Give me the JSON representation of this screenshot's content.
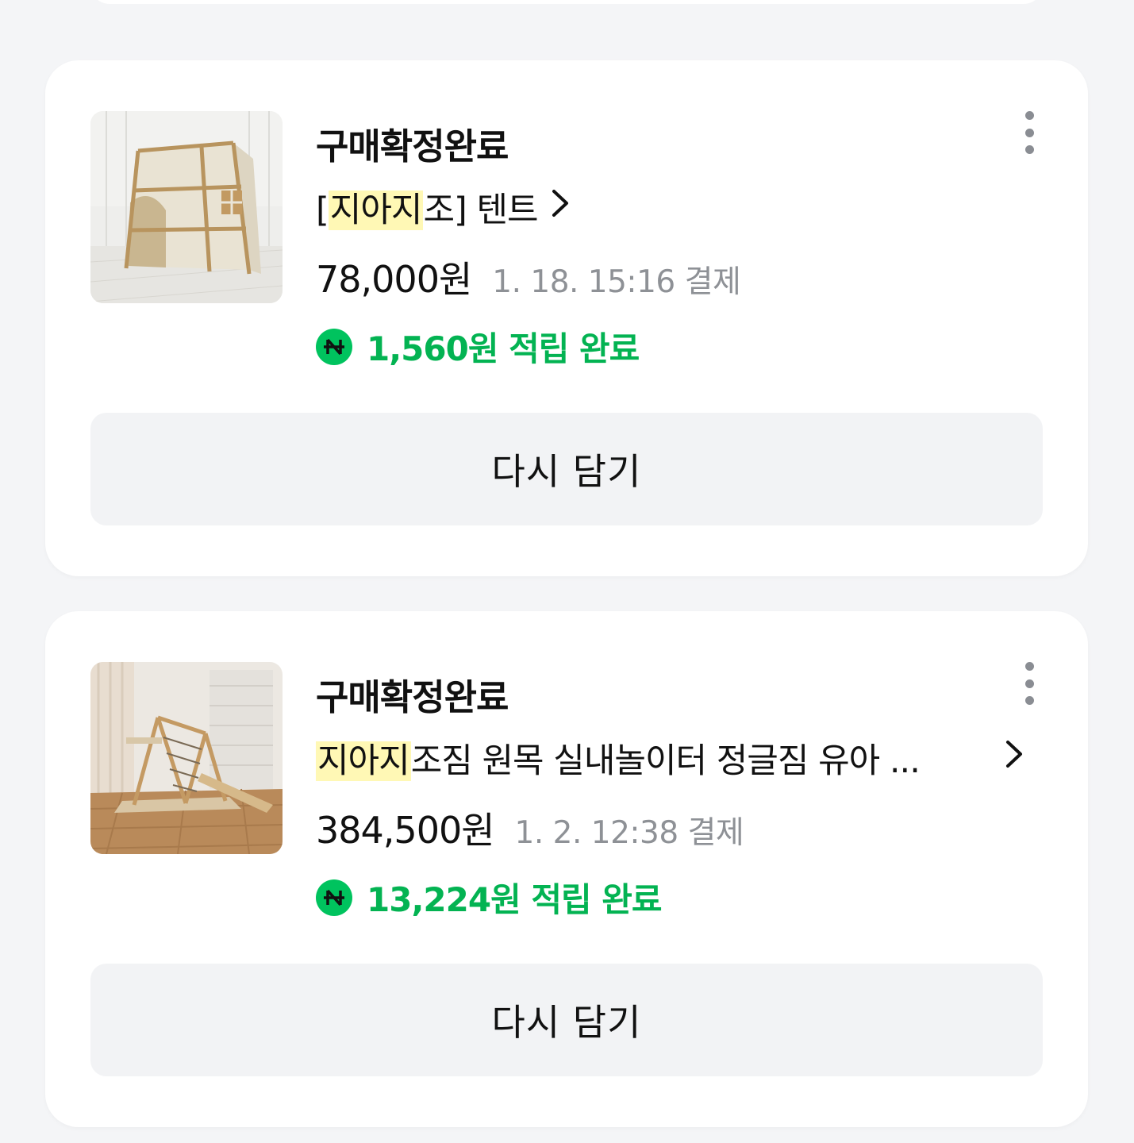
{
  "orders": [
    {
      "status": "구매확정완료",
      "title_highlight": "지아지",
      "title_before": "[",
      "title_after": "조] 텐트",
      "price": "78,000원",
      "paid_at": "1. 18. 15:16 결제",
      "points": "1,560원 적립 완료",
      "button_label": "다시 담기",
      "thumbnail": "tent-product-photo"
    },
    {
      "status": "구매확정완료",
      "title_highlight": "지아지",
      "title_before": "",
      "title_after": "조짐 원목 실내놀이터 정글짐 유아 ...",
      "price": "384,500원",
      "paid_at": "1. 2. 12:38 결제",
      "points": "13,224원 적립 완료",
      "button_label": "다시 담기",
      "thumbnail": "jungle-gym-product-photo"
    }
  ],
  "colors": {
    "background": "#f4f5f7",
    "point_green": "#03b352",
    "highlight": "#fff8b5",
    "muted_text": "#8e9196"
  },
  "icons": {
    "more": "more-vertical-icon",
    "chevron": "chevron-right-icon",
    "points": "naver-points-icon"
  }
}
